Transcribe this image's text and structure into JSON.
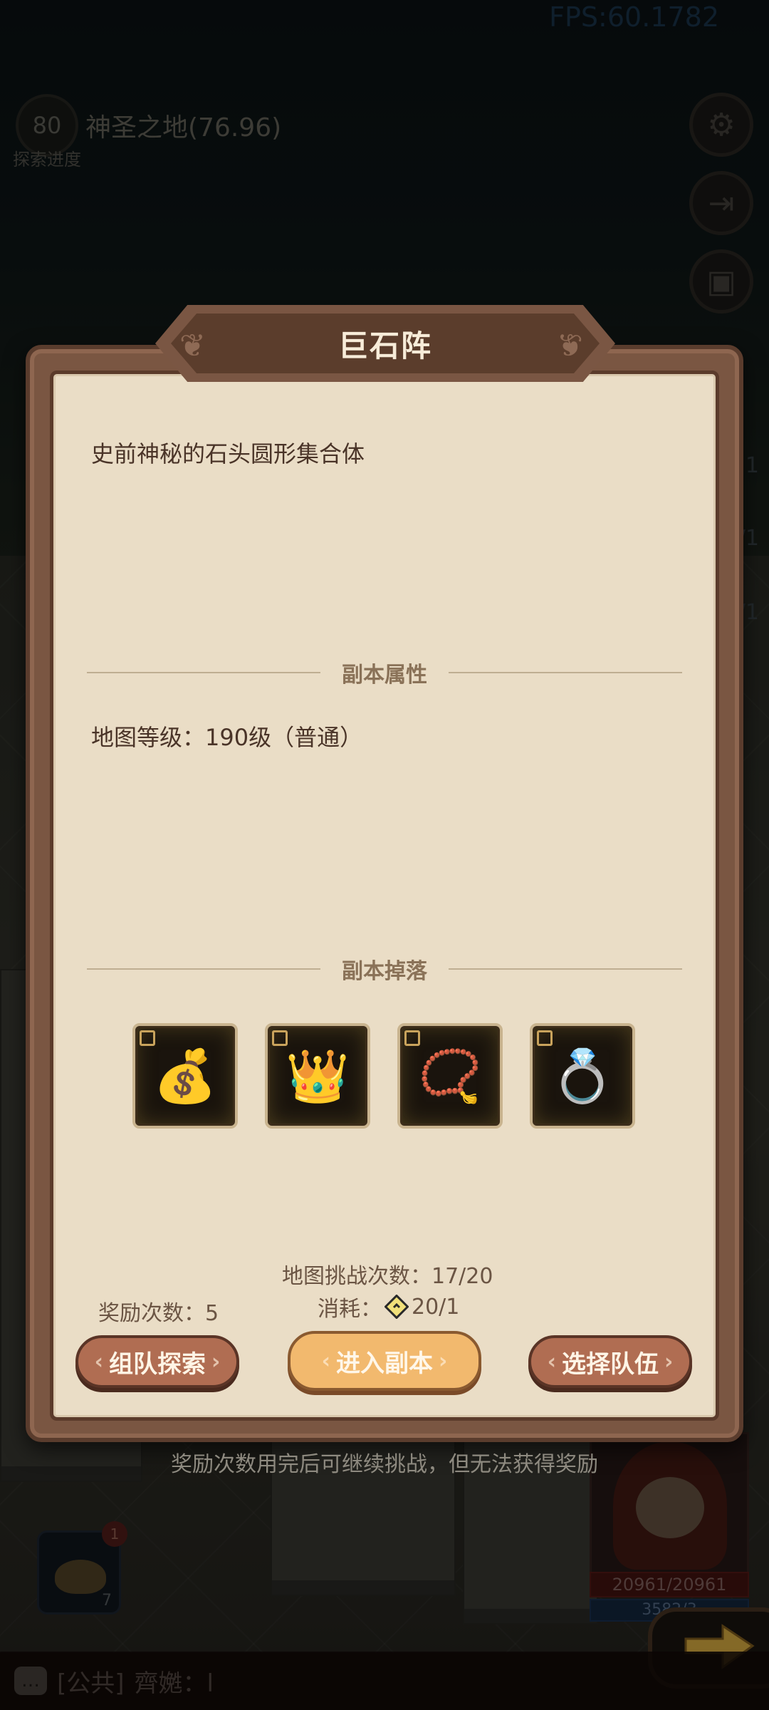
{
  "hud": {
    "fps": "FPS:60.1782",
    "level": "80",
    "zone_title": "神圣之地(76.96)",
    "zone_subtitle": "探索进度",
    "right_numbers": [
      "1",
      "/1",
      "/1"
    ]
  },
  "side_buttons": [
    {
      "icon": "gear-icon",
      "glyph": "⚙"
    },
    {
      "icon": "exit-icon",
      "glyph": "⇥"
    },
    {
      "icon": "chest-icon",
      "glyph": "▣"
    }
  ],
  "dialog": {
    "title": "巨石阵",
    "description": "史前神秘的石头圆形集合体",
    "section_attributes": "副本属性",
    "map_level": "地图等级：190级（普通）",
    "section_drops": "副本掉落",
    "drops": [
      {
        "icon": "coin-bag-icon",
        "glyph": "💰"
      },
      {
        "icon": "crown-icon",
        "glyph": "👑"
      },
      {
        "icon": "bracelet-icon",
        "glyph": "📿"
      },
      {
        "icon": "ring-icon",
        "glyph": "💍"
      }
    ],
    "challenge_count": "地图挑战次数：17/20",
    "reward_count": "奖励次数：5",
    "cost_label": "消耗：",
    "cost_value": "20/1",
    "buttons": {
      "team_explore": "组队探索",
      "enter_dungeon": "进入副本",
      "select_team": "选择队伍"
    },
    "footer_note": "奖励次数用完后可继续挑战，但无法获得奖励"
  },
  "bag": {
    "count": "7",
    "badge": "1"
  },
  "hero": {
    "hp": "20961/20961",
    "mp": "3582/3"
  },
  "chat": {
    "channel": "[公共]",
    "text": "齊嬎：l"
  }
}
